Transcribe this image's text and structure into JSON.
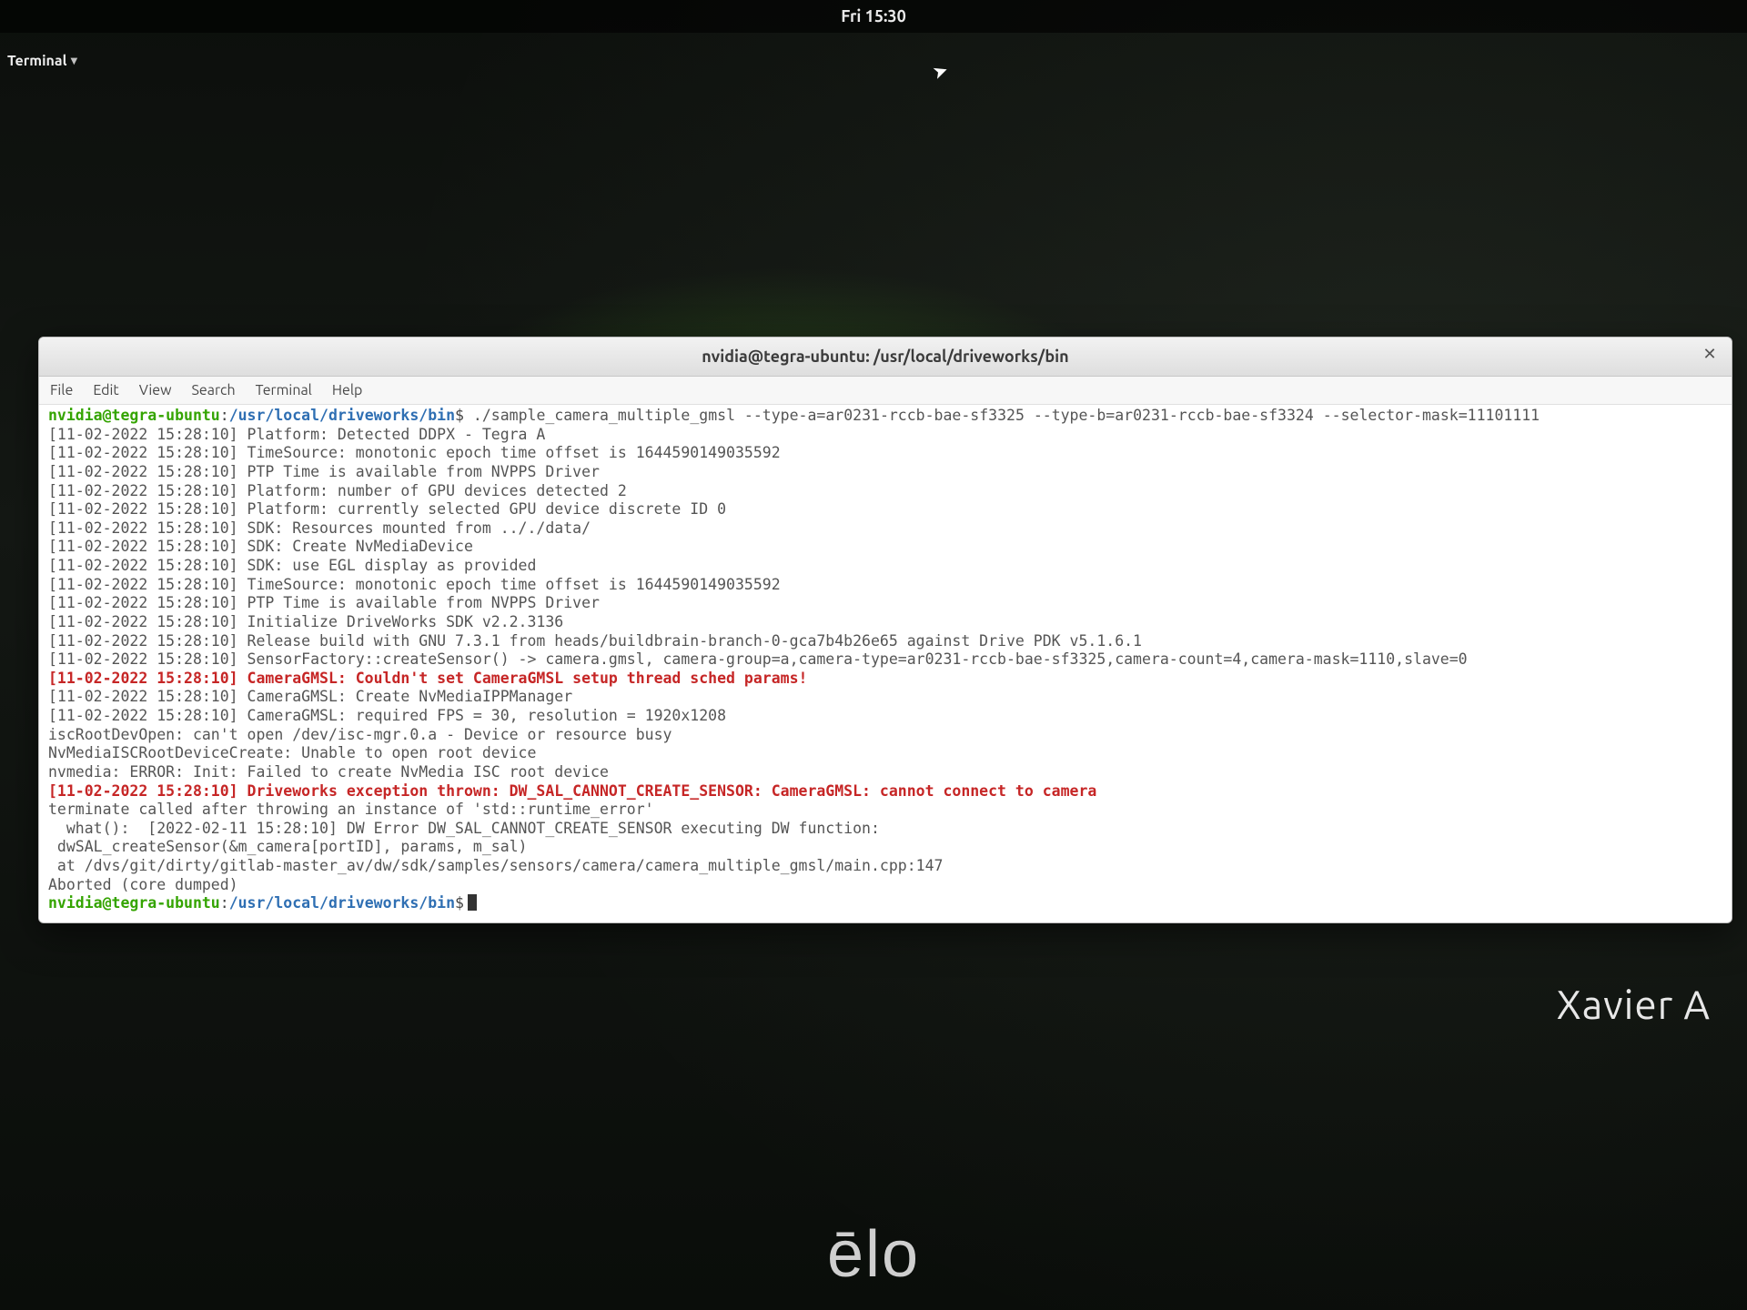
{
  "system": {
    "clock": "Fri 15:30",
    "app_indicator": "Terminal",
    "device_label": "Xavier A",
    "brand": "ēlo"
  },
  "window": {
    "title": "nvidia@tegra-ubuntu: /usr/local/driveworks/bin",
    "menu": {
      "file": "File",
      "edit": "Edit",
      "view": "View",
      "search": "Search",
      "terminal": "Terminal",
      "help": "Help"
    }
  },
  "prompt": {
    "user": "nvidia@tegra-ubuntu",
    "path": "/usr/local/driveworks/bin",
    "sep": ":",
    "sym": "$"
  },
  "command": "./sample_camera_multiple_gmsl --type-a=ar0231-rccb-bae-sf3325 --type-b=ar0231-rccb-bae-sf3324 --selector-mask=11101111",
  "log": {
    "l01": "[11-02-2022 15:28:10] Platform: Detected DDPX - Tegra A",
    "l02": "[11-02-2022 15:28:10] TimeSource: monotonic epoch time offset is 1644590149035592",
    "l03": "[11-02-2022 15:28:10] PTP Time is available from NVPPS Driver",
    "l04": "[11-02-2022 15:28:10] Platform: number of GPU devices detected 2",
    "l05": "[11-02-2022 15:28:10] Platform: currently selected GPU device discrete ID 0",
    "l06": "[11-02-2022 15:28:10] SDK: Resources mounted from .././data/",
    "l07": "[11-02-2022 15:28:10] SDK: Create NvMediaDevice",
    "l08": "[11-02-2022 15:28:10] SDK: use EGL display as provided",
    "l09": "[11-02-2022 15:28:10] TimeSource: monotonic epoch time offset is 1644590149035592",
    "l10": "[11-02-2022 15:28:10] PTP Time is available from NVPPS Driver",
    "l11": "[11-02-2022 15:28:10] Initialize DriveWorks SDK v2.2.3136",
    "l12": "[11-02-2022 15:28:10] Release build with GNU 7.3.1 from heads/buildbrain-branch-0-gca7b4b26e65 against Drive PDK v5.1.6.1",
    "l13": "[11-02-2022 15:28:10] SensorFactory::createSensor() -> camera.gmsl, camera-group=a,camera-type=ar0231-rccb-bae-sf3325,camera-count=4,camera-mask=1110,slave=0",
    "l14": "[11-02-2022 15:28:10] CameraGMSL: Couldn't set CameraGMSL setup thread sched params!",
    "l15": "[11-02-2022 15:28:10] CameraGMSL: Create NvMediaIPPManager",
    "l16": "[11-02-2022 15:28:10] CameraGMSL: required FPS = 30, resolution = 1920x1208",
    "l17": "iscRootDevOpen: can't open /dev/isc-mgr.0.a - Device or resource busy",
    "l18": "NvMediaISCRootDeviceCreate: Unable to open root device",
    "l19": "nvmedia: ERROR: Init: Failed to create NvMedia ISC root device",
    "l20": "[11-02-2022 15:28:10] Driveworks exception thrown: DW_SAL_CANNOT_CREATE_SENSOR: CameraGMSL: cannot connect to camera",
    "l21": "",
    "l22": "terminate called after throwing an instance of 'std::runtime_error'",
    "l23": "  what():  [2022-02-11 15:28:10] DW Error DW_SAL_CANNOT_CREATE_SENSOR executing DW function:",
    "l24": " dwSAL_createSensor(&m_camera[portID], params, m_sal)",
    "l25": " at /dvs/git/dirty/gitlab-master_av/dw/sdk/samples/sensors/camera/camera_multiple_gmsl/main.cpp:147",
    "l26": "Aborted (core dumped)"
  }
}
